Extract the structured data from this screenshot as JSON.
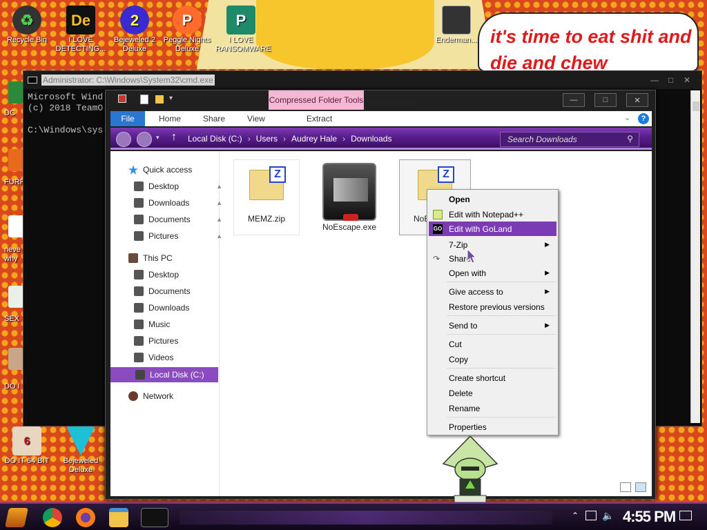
{
  "desktop": {
    "icons": [
      {
        "label": "Recycle Bin"
      },
      {
        "label": "I LOVE DETECTING..."
      },
      {
        "label": "Bejeweled 2 Deluxe"
      },
      {
        "label": "Peggle Nights Deluxe"
      },
      {
        "label": "I LOVE RANSOMWARE"
      },
      {
        "label": "Enderman..."
      },
      {
        "label": "DO IT 64 BIT"
      },
      {
        "label": "Bejeweled Deluxe"
      }
    ],
    "edge_labels": [
      "DC",
      "FURF",
      "neve why",
      "SEX",
      "DO I"
    ],
    "speech_text": "it's time to eat shit and die and chew"
  },
  "cmd": {
    "title": "Administrator: C:\\Windows\\System32\\cmd.exe",
    "lines": [
      "Microsoft Wind",
      "(c) 2018 TeamO",
      "",
      "C:\\Windows\\sys"
    ]
  },
  "explorer": {
    "contextual_tab": "Compressed Folder Tools",
    "title": "Downloads",
    "ribbon": {
      "file": "File",
      "home": "Home",
      "share": "Share",
      "view": "View",
      "extract": "Extract"
    },
    "breadcrumbs": [
      "Local Disk (C:)",
      "Users",
      "Audrey Hale",
      "Downloads"
    ],
    "search_placeholder": "Search Downloads",
    "nav": {
      "quick_access": "Quick access",
      "quick_items": [
        "Desktop",
        "Downloads",
        "Documents",
        "Pictures"
      ],
      "this_pc": "This PC",
      "pc_items": [
        "Desktop",
        "Documents",
        "Downloads",
        "Music",
        "Pictures",
        "Videos",
        "Local Disk (C:)"
      ],
      "network": "Network"
    },
    "files": [
      {
        "name": "MEMZ.zip"
      },
      {
        "name": "NoEscape.exe"
      },
      {
        "name": "NoE"
      }
    ]
  },
  "context_menu": {
    "items": [
      "Open",
      "Edit with Notepad++",
      "Edit with GoLand",
      "7-Zip",
      "Share",
      "Open with",
      "Give access to",
      "Restore previous versions",
      "Send to",
      "Cut",
      "Copy",
      "Create shortcut",
      "Delete",
      "Rename",
      "Properties"
    ],
    "highlighted": "Edit with GoLand",
    "highlight_color": "#7a3bb5"
  },
  "taskbar": {
    "clock": "4:55 PM"
  }
}
